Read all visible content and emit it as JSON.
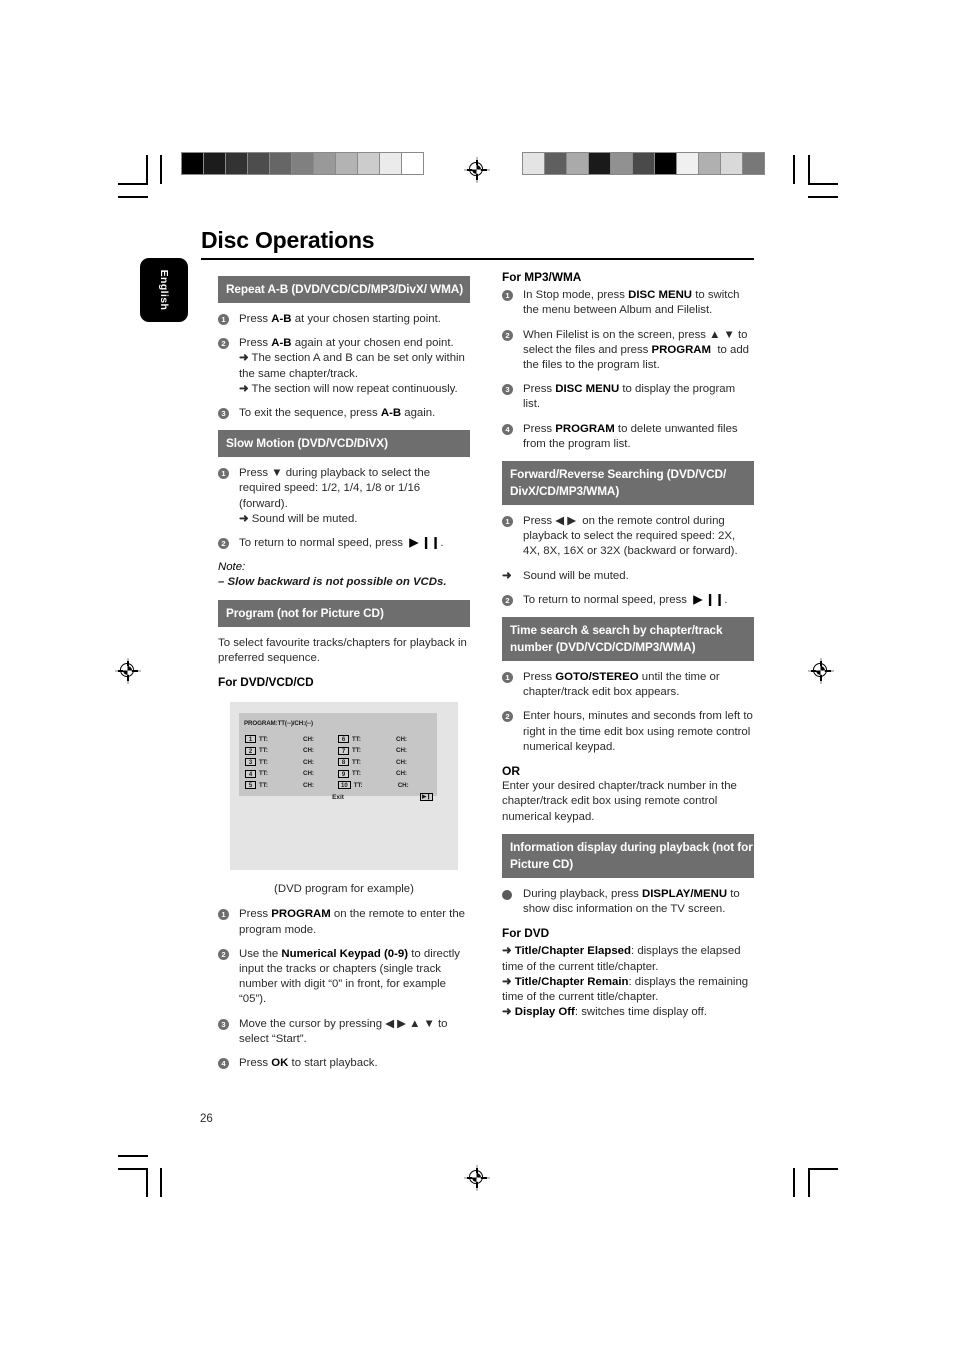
{
  "page": {
    "title": "Disc Operations",
    "language_tab": "English",
    "page_number": "26"
  },
  "left_column": {
    "repeat_ab": {
      "heading": "Repeat A-B (DVD/VCD/CD/MP3/DivX/ WMA)",
      "steps": [
        {
          "num": "1",
          "html": "Press <b>A-B</b> at your chosen starting point."
        },
        {
          "num": "2",
          "html": "Press <b>A-B</b> again at your chosen end point.<br><span class=\"arrow\">➜</span> The section A and B can be set only within the same chapter/track.<br><span class=\"arrow\">➜</span> The section will now repeat continuously."
        },
        {
          "num": "3",
          "html": "To exit the sequence, press <b>A-B</b> again."
        }
      ]
    },
    "slow_motion": {
      "heading": "Slow Motion (DVD/VCD/DiVX)",
      "steps": [
        {
          "num": "1",
          "html": "Press ▼ during playback to select the required speed: 1/2, 1/4, 1/8 or 1/16 (forward).<br><span class=\"arrow\">➜</span> Sound will be muted."
        },
        {
          "num": "2",
          "html": "To return to normal speed, press &nbsp;<b>▶ ❙❙</b>."
        }
      ],
      "note_label": "Note:",
      "note_text": "–  Slow backward is not possible on VCDs."
    },
    "program": {
      "heading": "Program (not for Picture CD)",
      "intro": "To select favourite tracks/chapters for playback in preferred sequence.",
      "subhead": "For DVD/VCD/CD",
      "figure": {
        "osd_title": "PROGRAM:TT(--)/CH:(--)",
        "rows": [
          {
            "left_num": "1",
            "left_tt": "TT:",
            "left_ch": "CH:",
            "right_num": "6",
            "right_tt": "TT:",
            "right_ch": "CH:"
          },
          {
            "left_num": "2",
            "left_tt": "TT:",
            "left_ch": "CH:",
            "right_num": "7",
            "right_tt": "TT:",
            "right_ch": "CH:"
          },
          {
            "left_num": "3",
            "left_tt": "TT:",
            "left_ch": "CH:",
            "right_num": "8",
            "right_tt": "TT:",
            "right_ch": "CH:"
          },
          {
            "left_num": "4",
            "left_tt": "TT:",
            "left_ch": "CH:",
            "right_num": "9",
            "right_tt": "TT:",
            "right_ch": "CH:"
          },
          {
            "left_num": "5",
            "left_tt": "TT:",
            "left_ch": "CH:",
            "right_num": "10",
            "right_tt": "TT:",
            "right_ch": "CH:"
          }
        ],
        "exit_label": "Exit",
        "skip_icon": "▶❙",
        "caption": "(DVD program for example)"
      },
      "steps": [
        {
          "num": "1",
          "html": "Press <b>PROGRAM</b> on the remote to enter the program mode."
        },
        {
          "num": "2",
          "html": "Use the <b>Numerical Keypad (0-9)</b> to directly input the tracks or chapters (single track number with digit “0” in front, for example “05”)."
        },
        {
          "num": "3",
          "html": "Move the cursor by pressing ◀ ▶ ▲ ▼ to select “Start”."
        },
        {
          "num": "4",
          "html": "Press <b>OK</b> to start playback."
        }
      ]
    }
  },
  "right_column": {
    "mp3_wma": {
      "subhead": "For MP3/WMA",
      "steps": [
        {
          "num": "1",
          "html": "In Stop mode, press <b>DISC MENU</b> to switch the menu between Album and Filelist."
        },
        {
          "num": "2",
          "html": "When Filelist is on the screen, press ▲ ▼ to select the files and press <b>PROGRAM</b> &nbsp;to add the files to the program list."
        },
        {
          "num": "3",
          "html": "Press <b>DISC MENU</b> to display the program list."
        },
        {
          "num": "4",
          "html": "Press <b>PROGRAM</b> to delete unwanted files from the program list."
        }
      ]
    },
    "search": {
      "heading": "Forward/Reverse Searching (DVD/VCD/ DivX/CD/MP3/WMA)",
      "steps": [
        {
          "num": "1",
          "html": "Press ◀ ▶ &nbsp;on the remote control during playback to select the required speed: 2X, 4X, 8X, 16X or 32X (backward or forward)."
        },
        {
          "num": "arrow",
          "html": "Sound will be muted."
        },
        {
          "num": "2",
          "html": "To return to normal speed, press &nbsp;<b>▶ ❙❙</b>."
        }
      ]
    },
    "time_search": {
      "heading": "Time search & search by chapter/track number (DVD/VCD/CD/MP3/WMA)",
      "steps": [
        {
          "num": "1",
          "html": "Press <b>GOTO/STEREO</b> until the time or chapter/track edit box appears."
        },
        {
          "num": "2",
          "html": "Enter hours, minutes and seconds from left to right in the time edit box using remote control numerical keypad."
        }
      ],
      "or_label": "OR",
      "or_text": "Enter your desired chapter/track number in the chapter/track edit box using remote control numerical keypad."
    },
    "info_display": {
      "heading": "Information display during playback (not for Picture CD)",
      "bullet": "During playback, press <b>DISPLAY/MENU</b> to show disc information on the TV screen.",
      "subhead": "For DVD",
      "items": [
        "<b>Title/Chapter Elapsed</b>: displays the elapsed time of the current title/chapter.",
        "<b>Title/Chapter Remain</b>: displays the remaining time of the current title/chapter.",
        "<b>Display Off</b>: switches time display off."
      ]
    }
  },
  "print_marks": {
    "grey_strip_left": [
      "#000000",
      "#1c1c1c",
      "#333333",
      "#4d4d4d",
      "#666666",
      "#808080",
      "#999999",
      "#b3b3b3",
      "#cccccc",
      "#ebebeb",
      "#ffffff"
    ],
    "grey_strip_right": [
      "#e4e4e4",
      "#5f5f5f",
      "#aaaaaa",
      "#1a1a1a",
      "#919191",
      "#4a4a4a",
      "#000000",
      "#f0f0f0",
      "#b0b0b0",
      "#d9d9d9",
      "#787878"
    ]
  }
}
